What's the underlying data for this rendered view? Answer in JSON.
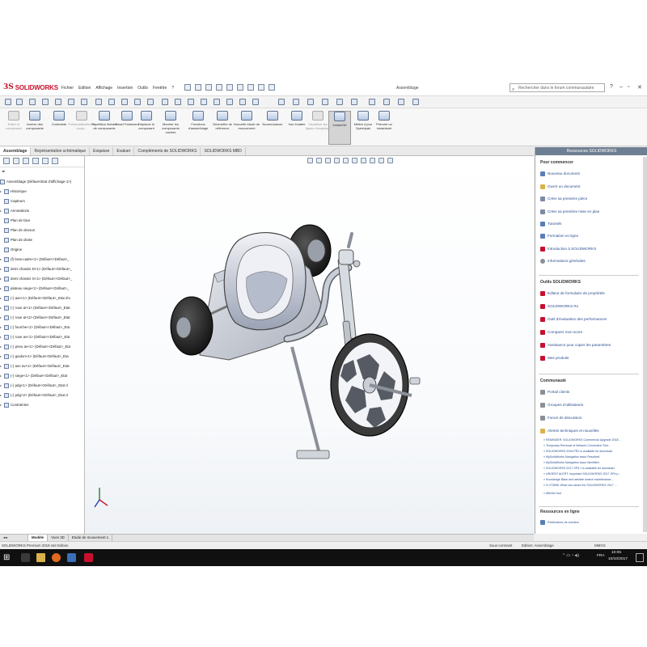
{
  "app": {
    "logo_text": "SOLIDWORKS",
    "menus": [
      "Fichier",
      "Edition",
      "Affichage",
      "Insertion",
      "Outils",
      "Fenêtre",
      "?"
    ],
    "document_title": "Assemblage",
    "search_placeholder": "Rechercher dans le forum communautaire"
  },
  "ribbon": {
    "buttons": [
      {
        "label": "Editer le composant",
        "state": "disabled"
      },
      {
        "label": "Insérer des composants",
        "state": "normal"
      },
      {
        "label": "Contrainte",
        "state": "normal"
      },
      {
        "label": "Prévisualisation du comp...",
        "state": "disabled"
      },
      {
        "label": "Répétition linéaire de composants",
        "state": "normal"
      },
      {
        "label": "Smart Fasteners",
        "state": "normal"
      },
      {
        "label": "Déplacer le composant",
        "state": "normal"
      },
      {
        "label": "Montrer les composants cachés",
        "state": "normal"
      },
      {
        "label": "Fonctions d'assemblage",
        "state": "normal"
      },
      {
        "label": "Géométrie de référence",
        "state": "normal"
      },
      {
        "label": "Nouvelle étude de mouvement",
        "state": "normal"
      },
      {
        "label": "Nomenclature",
        "state": "normal"
      },
      {
        "label": "Vue éclatée",
        "state": "normal"
      },
      {
        "label": "Visualiser les lignes d'esquisse",
        "state": "disabled"
      },
      {
        "label": "Instant3D",
        "state": "active"
      },
      {
        "label": "Mettre à jour Speedpak",
        "state": "normal"
      },
      {
        "label": "Prendre un instantané",
        "state": "normal"
      }
    ]
  },
  "tabs": [
    "Assemblage",
    "Représentation schématique",
    "Esquisse",
    "Evaluer",
    "Compléments de SOLIDWORKS",
    "SOLIDWORKS MBD"
  ],
  "tree": {
    "items": [
      {
        "label": "Assemblage  (Défaut<Etat d'affichage-1>)",
        "kind": "root"
      },
      {
        "label": "Historique",
        "kind": "folder"
      },
      {
        "label": "Capteurs",
        "kind": "folder"
      },
      {
        "label": "Annotations",
        "kind": "folder"
      },
      {
        "label": "Plan de face",
        "kind": "plane"
      },
      {
        "label": "Plan de dessus",
        "kind": "plane"
      },
      {
        "label": "Plan de droite",
        "kind": "plane"
      },
      {
        "label": "Origine",
        "kind": "origin"
      },
      {
        "label": "(f) bras-cadre<1> (Défaut<<Défaut>_",
        "kind": "part"
      },
      {
        "label": "demi chassis D<1> (Défaut<<Défaut>_",
        "kind": "part"
      },
      {
        "label": "demi chassis G<1> (Défaut<<Défaut>_",
        "kind": "part"
      },
      {
        "label": "plateau siege<1> (Défaut<<Défaut>_",
        "kind": "part"
      },
      {
        "label": "(-) axe<1> (Défaut<<Défaut>_Etat d'a",
        "kind": "part"
      },
      {
        "label": "(-) roue ar<1> (Défaut<<Défaut>_Etat",
        "kind": "part"
      },
      {
        "label": "(-) roue ar<2> (Défaut<<Défaut>_Etat",
        "kind": "part"
      },
      {
        "label": "(-) fourche<1> (Défaut<<Défaut>_Eta",
        "kind": "part"
      },
      {
        "label": "(-) roue av<1> (Défaut<<Défaut>_Eta",
        "kind": "part"
      },
      {
        "label": "(-) pneu av<1> (Défaut<<Défaut>_Eta",
        "kind": "part"
      },
      {
        "label": "(-) guidon<1> (Défaut<<Défaut>_Eta",
        "kind": "part"
      },
      {
        "label": "(-) axe av<1> (Défaut<<Défaut>_Etat",
        "kind": "part"
      },
      {
        "label": "(-) siege<1> (Défaut<<Défaut>_Etat",
        "kind": "part"
      },
      {
        "label": "(-) pdg<1> (Défaut<<Défaut>_Etat d",
        "kind": "part"
      },
      {
        "label": "(-) pdg<2> (Défaut<<Défaut>_Etat d",
        "kind": "part"
      },
      {
        "label": "Contraintes",
        "kind": "mates"
      }
    ]
  },
  "resources": {
    "header": "Ressources SOLIDWORKS",
    "getting_started": {
      "title": "Pour commencer",
      "items": [
        "Nouveau document",
        "Ouvrir un document",
        "Créer sa première pièce",
        "Créer sa première mise en plan",
        "Tutoriels",
        "Formation en ligne",
        "Introduction à SOLIDWORKS",
        "Informations générales"
      ]
    },
    "tools": {
      "title": "Outils SOLIDWORKS",
      "items": [
        "Editeur de formulaire de propriétés",
        "SOLIDWORKS Rx",
        "Outil d'évaluation des performances",
        "Comparer mon score",
        "Assistance pour copier les paramètres",
        "Mes produits"
      ]
    },
    "community": {
      "title": "Communauté",
      "items": [
        "Portail clients",
        "Groupes d'utilisateurs",
        "Forum de discussion",
        "Alertes techniques et nouvelles"
      ],
      "news": [
        "REMINDER: SOLIDWORKS Commercial Upgrade 2018 ...",
        "Temporary Removal of Network Connection Tool...",
        "SOLIDWORKS 2018 PR1 is available for download",
        "MySolidWorks Navigation issue Resolved",
        "MySolidWorks Navigation issue identified",
        "SOLIDWORKS 2017 SP4.1 is available for download",
        "URGENT ALERT: Important SOLIDWORKS 2017 SP4 p...",
        "Knowledge Base and website search maintenance...",
        "S-073698: What can cause the SOLIDWORKS 2017 ..."
      ],
      "more": "Afficher tout"
    },
    "online": {
      "title": "Ressources en ligne",
      "item": "Partenaires de solution"
    }
  },
  "bottom_tabs": [
    "Modèle",
    "Vues 3D",
    "Etude de mouvement 1"
  ],
  "status": {
    "product": "SOLIDWORKS Premium 2018 x64 Edition",
    "state": "Sous-contraint",
    "mode": "Edition: Assemblage",
    "units": "MMGS"
  },
  "taskbar": {
    "lang": "FRA",
    "time": "10:05",
    "date": "10/10/2017"
  },
  "colors": {
    "accent": "#c8102e",
    "panel_header": "#6f7f93",
    "taskbar": "#101010",
    "model_body": "#c5cad3",
    "tire": "#1e1e1e"
  }
}
